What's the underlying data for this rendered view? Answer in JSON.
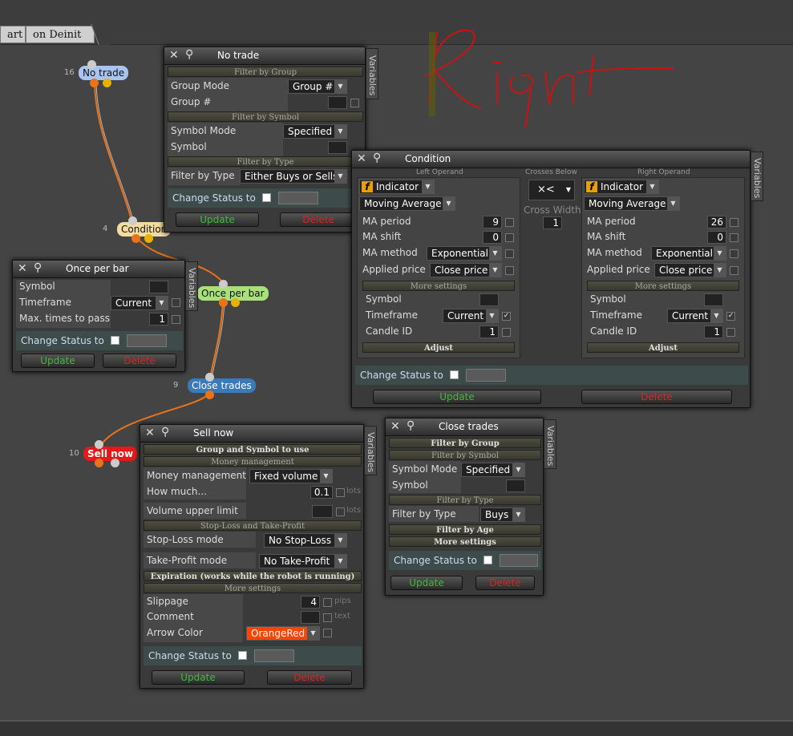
{
  "tabs": [
    {
      "label": "art"
    },
    {
      "label": "on Deinit"
    }
  ],
  "annotation_text": "Right",
  "nodes": {
    "no_trade": {
      "num": "16",
      "label": "No trade"
    },
    "condition": {
      "num": "4",
      "label": "Condition"
    },
    "once_per_bar": {
      "label": "Once per bar"
    },
    "close_trades": {
      "num": "9",
      "label": "Close trades"
    },
    "sell_now": {
      "num": "10",
      "label": "Sell now"
    }
  },
  "common": {
    "variables": "Variables",
    "update": "Update",
    "delete": "Delete",
    "change_status": "Change Status to",
    "close": "✕",
    "pin": "⚲"
  },
  "no_trade_panel": {
    "title": "No trade",
    "sec_group": "Filter by Group",
    "group_mode_label": "Group Mode",
    "group_mode_value": "Group #",
    "group_num_label": "Group #",
    "sec_symbol": "Filter by Symbol",
    "symbol_mode_label": "Symbol Mode",
    "symbol_mode_value": "Specified",
    "symbol_label": "Symbol",
    "sec_type": "Filter by Type",
    "filter_type_label": "Filter by Type",
    "filter_type_value": "Either Buys or Sells"
  },
  "once_panel": {
    "title": "Once per bar",
    "symbol_label": "Symbol",
    "timeframe_label": "Timeframe",
    "timeframe_value": "Current",
    "max_label": "Max. times to pass",
    "max_value": "1"
  },
  "condition_panel": {
    "title": "Condition",
    "left_head": "Left Operand",
    "mid_head": "Crosses Below",
    "right_head": "Right Operand",
    "indicator": "Indicator",
    "ma": "Moving Average",
    "op": "×<",
    "cross_width_label": "Cross Width",
    "cross_width_value": "1",
    "period_label": "MA period",
    "shift_label": "MA shift",
    "method_label": "MA method",
    "price_label": "Applied price",
    "method_value": "Exponential",
    "price_value": "Close price",
    "more": "More settings",
    "symbol_label": "Symbol",
    "timeframe_label": "Timeframe",
    "timeframe_value": "Current",
    "candle_label": "Candle ID",
    "candle_value": "1",
    "adjust": "Adjust",
    "left_period": "9",
    "left_shift": "0",
    "right_period": "26",
    "right_shift": "0"
  },
  "sell_panel": {
    "title": "Sell now",
    "sec1": "Group and Symbol to use",
    "sec2": "Money management",
    "mm_label": "Money management",
    "mm_value": "Fixed volume",
    "how_label": "How much...",
    "how_value": "0.1",
    "lots": "lots",
    "vol_label": "Volume upper limit",
    "sec3": "Stop-Loss and Take-Profit",
    "sl_label": "Stop-Loss mode",
    "sl_value": "No Stop-Loss",
    "tp_label": "Take-Profit mode",
    "tp_value": "No Take-Profit",
    "sec4": "Expiration (works while the robot is running)",
    "sec5": "More settings",
    "slip_label": "Slippage",
    "slip_value": "4",
    "pips": "pips",
    "comment_label": "Comment",
    "text": "text",
    "arrow_label": "Arrow Color",
    "arrow_value": "OrangeRed"
  },
  "close_panel": {
    "title": "Close trades",
    "sec1": "Filter by Group",
    "sec2": "Filter by Symbol",
    "symbol_mode_label": "Symbol Mode",
    "symbol_mode_value": "Specified",
    "symbol_label": "Symbol",
    "sec3": "Filter by Type",
    "type_label": "Filter by Type",
    "type_value": "Buys",
    "sec4": "Filter by Age",
    "sec5": "More settings"
  },
  "colors": {
    "accent_update": "#3dbb3d",
    "accent_delete": "#e02020",
    "annotation": "#cc1111"
  }
}
